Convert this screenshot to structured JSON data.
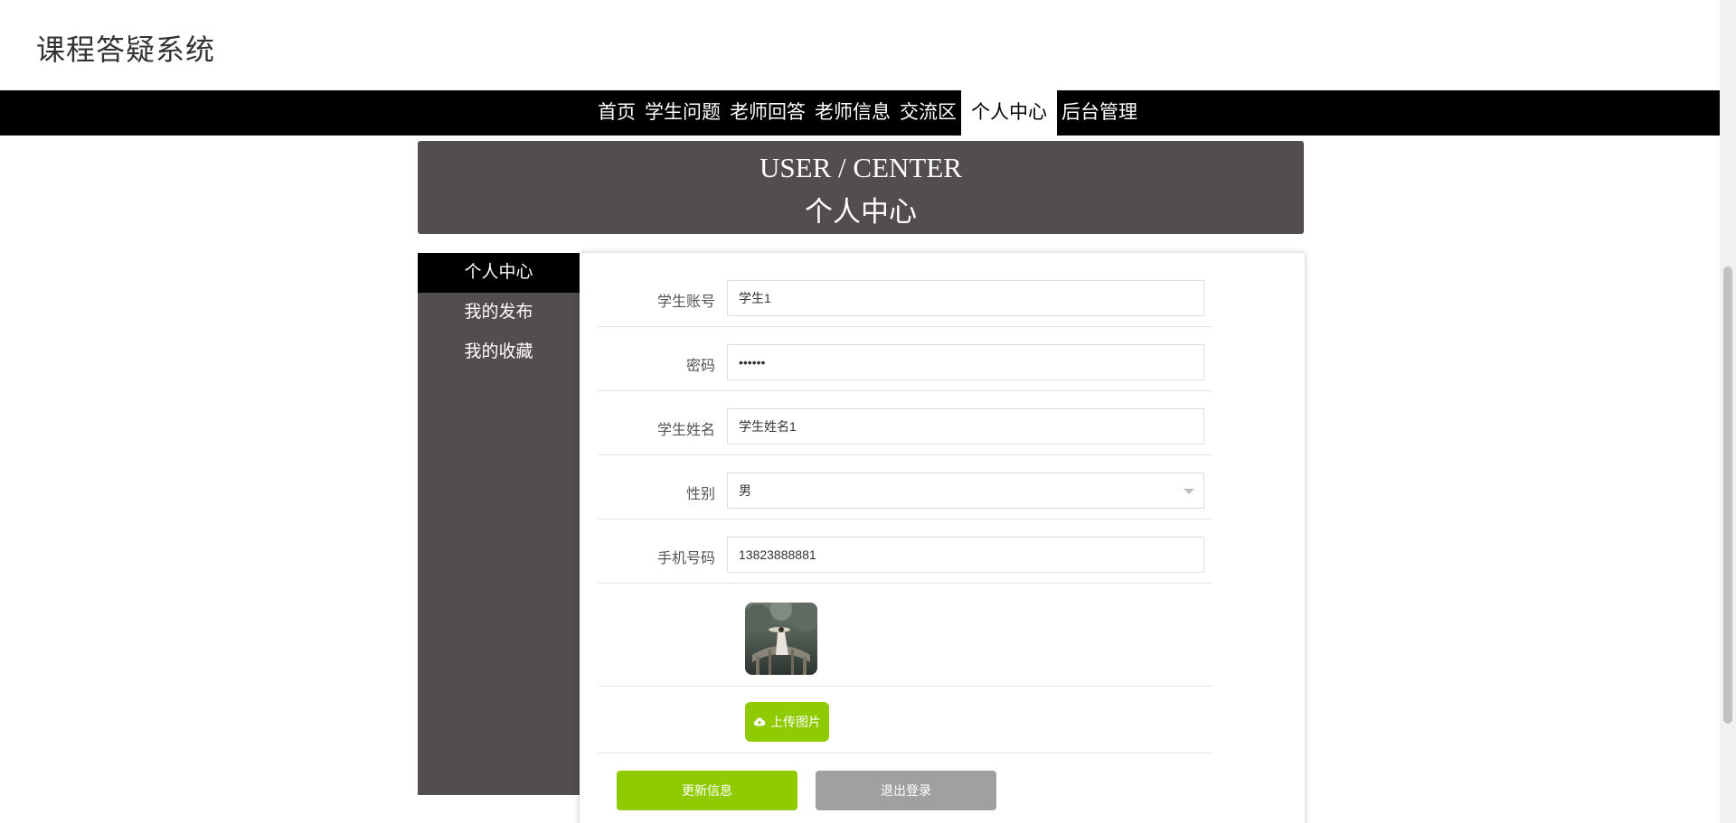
{
  "site": {
    "title": "课程答疑系统"
  },
  "nav": {
    "items": [
      {
        "label": "首页"
      },
      {
        "label": "学生问题"
      },
      {
        "label": "老师回答"
      },
      {
        "label": "老师信息"
      },
      {
        "label": "交流区"
      },
      {
        "label": "个人中心"
      },
      {
        "label": "后台管理"
      }
    ],
    "active_index": 5
  },
  "banner": {
    "en": "USER / CENTER",
    "cn": "个人中心"
  },
  "sidebar": {
    "items": [
      {
        "label": "个人中心"
      },
      {
        "label": "我的发布"
      },
      {
        "label": "我的收藏"
      }
    ],
    "active_index": 0
  },
  "form": {
    "account": {
      "label": "学生账号",
      "value": "学生1"
    },
    "password": {
      "label": "密码",
      "value": "••••••"
    },
    "name": {
      "label": "学生姓名",
      "value": "学生姓名1"
    },
    "gender": {
      "label": "性别",
      "value": "男"
    },
    "phone": {
      "label": "手机号码",
      "value": "13823888881"
    },
    "upload_label": "上传图片",
    "update_label": "更新信息",
    "logout_label": "退出登录"
  },
  "colors": {
    "accent": "#8fcb00",
    "banner_bg": "#544d4d",
    "nav_bg": "#000000",
    "logout_bg": "#a0a0a0"
  },
  "icons": {
    "upload": "cloud-upload-icon",
    "select": "chevron-down-icon"
  }
}
